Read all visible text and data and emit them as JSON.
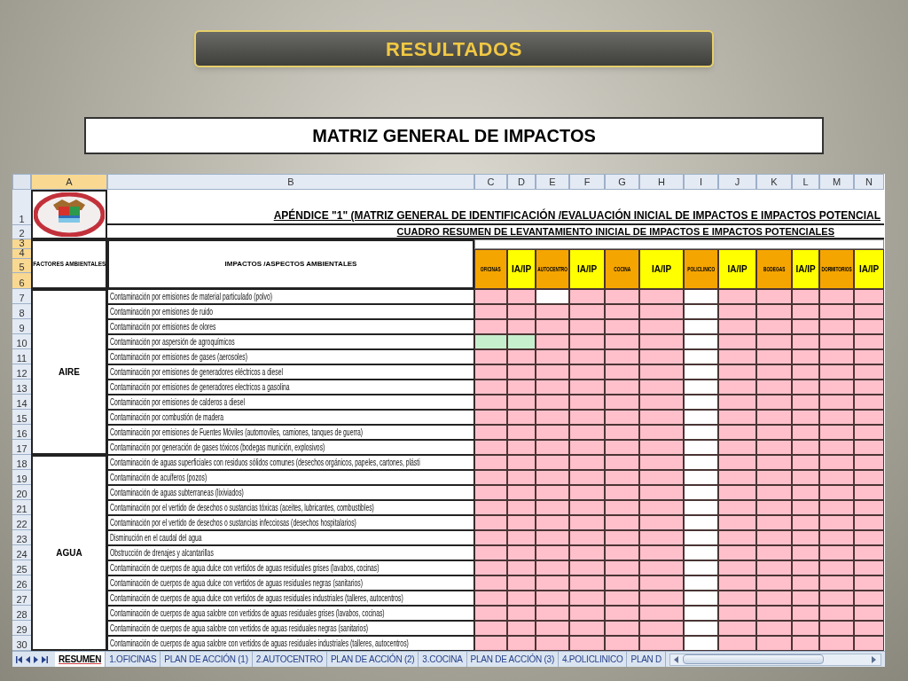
{
  "slide": {
    "banner": "RESULTADOS",
    "title": "MATRIZ GENERAL DE IMPACTOS"
  },
  "sheet": {
    "column_headers": [
      {
        "label": "A",
        "selected": true
      },
      {
        "label": "B",
        "selected": false
      },
      {
        "label": "C",
        "selected": false
      },
      {
        "label": "D",
        "selected": false
      },
      {
        "label": "E",
        "selected": false
      },
      {
        "label": "F",
        "selected": false
      },
      {
        "label": "G",
        "selected": false
      },
      {
        "label": "H",
        "selected": false
      },
      {
        "label": "I",
        "selected": false
      },
      {
        "label": "J",
        "selected": false
      },
      {
        "label": "K",
        "selected": false
      },
      {
        "label": "L",
        "selected": false
      },
      {
        "label": "M",
        "selected": false
      },
      {
        "label": "N",
        "selected": false
      }
    ],
    "row_headers": [
      {
        "label": "1",
        "selected": false
      },
      {
        "label": "2",
        "selected": false
      },
      {
        "label": "3",
        "selected": true
      },
      {
        "label": "4",
        "selected": true
      },
      {
        "label": "5",
        "selected": true
      },
      {
        "label": "6",
        "selected": true
      },
      {
        "label": "7",
        "selected": false
      },
      {
        "label": "8",
        "selected": false
      },
      {
        "label": "9",
        "selected": false
      },
      {
        "label": "10",
        "selected": false
      },
      {
        "label": "11",
        "selected": false
      },
      {
        "label": "12",
        "selected": false
      },
      {
        "label": "13",
        "selected": false
      },
      {
        "label": "14",
        "selected": false
      },
      {
        "label": "15",
        "selected": false
      },
      {
        "label": "16",
        "selected": false
      },
      {
        "label": "17",
        "selected": false
      },
      {
        "label": "18",
        "selected": false
      },
      {
        "label": "19",
        "selected": false
      },
      {
        "label": "20",
        "selected": false
      },
      {
        "label": "21",
        "selected": false
      },
      {
        "label": "22",
        "selected": false
      },
      {
        "label": "23",
        "selected": false
      },
      {
        "label": "24",
        "selected": false
      },
      {
        "label": "25",
        "selected": false
      },
      {
        "label": "26",
        "selected": false
      },
      {
        "label": "27",
        "selected": false
      },
      {
        "label": "28",
        "selected": false
      },
      {
        "label": "29",
        "selected": false
      },
      {
        "label": "30",
        "selected": false
      }
    ],
    "title": "APÉNDICE \"1\" (MATRIZ GENERAL DE IDENTIFICACIÓN /EVALUACIÓN INICIAL DE IMPACTOS E IMPACTOS POTENCIAL",
    "subtitle": "CUADRO RESUMEN DE LEVANTAMIENTO INICIAL DE IMPACTOS E IMPACTOS POTENCIALES",
    "factor_heading": "FACTORES AMBIENTALES",
    "impact_heading": "IMPACTOS /ASPECTOS AMBIENTALES",
    "area_columns": [
      {
        "label": "OFICINAS",
        "kind": "area"
      },
      {
        "label": "IA/IP",
        "kind": "rating"
      },
      {
        "label": "AUTOCENTRO",
        "kind": "area"
      },
      {
        "label": "IA/IP",
        "kind": "rating"
      },
      {
        "label": "COCINA",
        "kind": "area"
      },
      {
        "label": "IA/IP",
        "kind": "rating"
      },
      {
        "label": "POLICLINICO",
        "kind": "area"
      },
      {
        "label": "IA/IP",
        "kind": "rating"
      },
      {
        "label": "BODEGAS",
        "kind": "area"
      },
      {
        "label": "IA/IP",
        "kind": "rating"
      },
      {
        "label": "DORMITORIOS",
        "kind": "area"
      },
      {
        "label": "IA/IP",
        "kind": "rating"
      }
    ],
    "groups": [
      {
        "factor": "AIRE",
        "rows": [
          {
            "impact": "Contaminación por emisiones de material particulado (polvo)",
            "cells": [
              {
                "color": "#ffc0cb"
              },
              {
                "color": "#ffc0cb"
              },
              {
                "color": "#ffffff"
              },
              {
                "color": "#ffc0cb"
              },
              {
                "color": "#ffc0cb"
              },
              {
                "color": "#ffc0cb"
              },
              {
                "color": "#ffffff"
              },
              {
                "color": "#ffc0cb"
              },
              {
                "color": "#ffc0cb"
              },
              {
                "color": "#ffc0cb"
              },
              {
                "color": "#ffc0cb"
              },
              {
                "color": "#ffc0cb"
              }
            ]
          },
          {
            "impact": "Contaminación por emisiones de ruido",
            "cells": [
              {
                "color": "#ffc0cb"
              },
              {
                "color": "#ffc0cb"
              },
              {
                "color": "#ffc0cb"
              },
              {
                "color": "#ffc0cb"
              },
              {
                "color": "#ffc0cb"
              },
              {
                "color": "#ffc0cb"
              },
              {
                "color": "#ffffff"
              },
              {
                "color": "#ffc0cb"
              },
              {
                "color": "#ffc0cb"
              },
              {
                "color": "#ffc0cb"
              },
              {
                "color": "#ffc0cb"
              },
              {
                "color": "#ffc0cb"
              }
            ]
          },
          {
            "impact": "Contaminación por emisiones de olores",
            "cells": [
              {
                "color": "#ffc0cb"
              },
              {
                "color": "#ffc0cb"
              },
              {
                "color": "#ffc0cb"
              },
              {
                "color": "#ffc0cb"
              },
              {
                "color": "#ffc0cb"
              },
              {
                "color": "#ffc0cb"
              },
              {
                "color": "#ffffff"
              },
              {
                "color": "#ffc0cb"
              },
              {
                "color": "#ffc0cb"
              },
              {
                "color": "#ffc0cb"
              },
              {
                "color": "#ffc0cb"
              },
              {
                "color": "#ffc0cb"
              }
            ]
          },
          {
            "impact": "Contaminación por aspersión de agroquímicos",
            "cells": [
              {
                "color": "#c6efce"
              },
              {
                "color": "#c6efce"
              },
              {
                "color": "#ffc0cb"
              },
              {
                "color": "#ffc0cb"
              },
              {
                "color": "#ffc0cb"
              },
              {
                "color": "#ffc0cb"
              },
              {
                "color": "#ffffff"
              },
              {
                "color": "#ffc0cb"
              },
              {
                "color": "#ffc0cb"
              },
              {
                "color": "#ffc0cb"
              },
              {
                "color": "#ffc0cb"
              },
              {
                "color": "#ffc0cb"
              }
            ]
          },
          {
            "impact": "Contaminación por emisiones de gases (aerosoles)",
            "cells": [
              {
                "color": "#ffc0cb"
              },
              {
                "color": "#ffc0cb"
              },
              {
                "color": "#ffc0cb"
              },
              {
                "color": "#ffc0cb"
              },
              {
                "color": "#ffc0cb"
              },
              {
                "color": "#ffc0cb"
              },
              {
                "color": "#ffffff"
              },
              {
                "color": "#ffc0cb"
              },
              {
                "color": "#ffc0cb"
              },
              {
                "color": "#ffc0cb"
              },
              {
                "color": "#ffc0cb"
              },
              {
                "color": "#ffc0cb"
              }
            ]
          },
          {
            "impact": "Contaminación por emisiones de generadores eléctricos a diesel",
            "cells": [
              {
                "color": "#ffc0cb"
              },
              {
                "color": "#ffc0cb"
              },
              {
                "color": "#ffc0cb"
              },
              {
                "color": "#ffc0cb"
              },
              {
                "color": "#ffc0cb"
              },
              {
                "color": "#ffc0cb"
              },
              {
                "color": "#ffffff"
              },
              {
                "color": "#ffc0cb"
              },
              {
                "color": "#ffc0cb"
              },
              {
                "color": "#ffc0cb"
              },
              {
                "color": "#ffc0cb"
              },
              {
                "color": "#ffc0cb"
              }
            ]
          },
          {
            "impact": "Contaminación por emisiones de generadores electricos a gasolina",
            "cells": [
              {
                "color": "#ffc0cb"
              },
              {
                "color": "#ffc0cb"
              },
              {
                "color": "#ffc0cb"
              },
              {
                "color": "#ffc0cb"
              },
              {
                "color": "#ffc0cb"
              },
              {
                "color": "#ffc0cb"
              },
              {
                "color": "#ffffff"
              },
              {
                "color": "#ffc0cb"
              },
              {
                "color": "#ffc0cb"
              },
              {
                "color": "#ffc0cb"
              },
              {
                "color": "#ffc0cb"
              },
              {
                "color": "#ffc0cb"
              }
            ]
          },
          {
            "impact": "Contaminación por emisiones de calderos a diesel",
            "cells": [
              {
                "color": "#ffc0cb"
              },
              {
                "color": "#ffc0cb"
              },
              {
                "color": "#ffc0cb"
              },
              {
                "color": "#ffc0cb"
              },
              {
                "color": "#ffc0cb"
              },
              {
                "color": "#ffc0cb"
              },
              {
                "color": "#ffffff"
              },
              {
                "color": "#ffc0cb"
              },
              {
                "color": "#ffc0cb"
              },
              {
                "color": "#ffc0cb"
              },
              {
                "color": "#ffc0cb"
              },
              {
                "color": "#ffc0cb"
              }
            ]
          },
          {
            "impact": "Contaminación por combustión de madera",
            "cells": [
              {
                "color": "#ffc0cb"
              },
              {
                "color": "#ffc0cb"
              },
              {
                "color": "#ffc0cb"
              },
              {
                "color": "#ffc0cb"
              },
              {
                "color": "#ffc0cb"
              },
              {
                "color": "#ffc0cb"
              },
              {
                "color": "#ffffff"
              },
              {
                "color": "#ffc0cb"
              },
              {
                "color": "#ffc0cb"
              },
              {
                "color": "#ffc0cb"
              },
              {
                "color": "#ffc0cb"
              },
              {
                "color": "#ffc0cb"
              }
            ]
          },
          {
            "impact": "Contaminación por emisiones de Fuentes Móviles (automoviles, camiones, tanques de guerra)",
            "cells": [
              {
                "color": "#ffc0cb"
              },
              {
                "color": "#ffc0cb"
              },
              {
                "color": "#ffc0cb"
              },
              {
                "color": "#ffc0cb"
              },
              {
                "color": "#ffc0cb"
              },
              {
                "color": "#ffc0cb"
              },
              {
                "color": "#ffffff"
              },
              {
                "color": "#ffc0cb"
              },
              {
                "color": "#ffc0cb"
              },
              {
                "color": "#ffc0cb"
              },
              {
                "color": "#ffc0cb"
              },
              {
                "color": "#ffc0cb"
              }
            ]
          },
          {
            "impact": "Contaminación por generación de gases tóxicos (bodegas munición, explosivos)",
            "cells": [
              {
                "color": "#ffc0cb"
              },
              {
                "color": "#ffc0cb"
              },
              {
                "color": "#ffc0cb"
              },
              {
                "color": "#ffc0cb"
              },
              {
                "color": "#ffc0cb"
              },
              {
                "color": "#ffc0cb"
              },
              {
                "color": "#ffffff"
              },
              {
                "color": "#ffc0cb"
              },
              {
                "color": "#ffc0cb"
              },
              {
                "color": "#ffc0cb"
              },
              {
                "color": "#ffc0cb"
              },
              {
                "color": "#ffc0cb"
              }
            ]
          }
        ]
      },
      {
        "factor": "AGUA",
        "rows": [
          {
            "impact": "Contaminación de aguas superficiales con residuos sólidos comunes (desechos orgánicos, papeles, cartones, plásti",
            "cells": [
              {
                "color": "#ffc0cb"
              },
              {
                "color": "#ffc0cb"
              },
              {
                "color": "#ffc0cb"
              },
              {
                "color": "#ffc0cb"
              },
              {
                "color": "#ffc0cb"
              },
              {
                "color": "#ffc0cb"
              },
              {
                "color": "#ffffff"
              },
              {
                "color": "#ffc0cb"
              },
              {
                "color": "#ffc0cb"
              },
              {
                "color": "#ffc0cb"
              },
              {
                "color": "#ffc0cb"
              },
              {
                "color": "#ffc0cb"
              }
            ]
          },
          {
            "impact": "Contaminación de acuíferos (pozos)",
            "cells": [
              {
                "color": "#ffc0cb"
              },
              {
                "color": "#ffc0cb"
              },
              {
                "color": "#ffc0cb"
              },
              {
                "color": "#ffc0cb"
              },
              {
                "color": "#ffc0cb"
              },
              {
                "color": "#ffc0cb"
              },
              {
                "color": "#ffffff"
              },
              {
                "color": "#ffc0cb"
              },
              {
                "color": "#ffc0cb"
              },
              {
                "color": "#ffc0cb"
              },
              {
                "color": "#ffc0cb"
              },
              {
                "color": "#ffc0cb"
              }
            ]
          },
          {
            "impact": "Contaminación de aguas subterraneas (lixiviados)",
            "cells": [
              {
                "color": "#ffc0cb"
              },
              {
                "color": "#ffc0cb"
              },
              {
                "color": "#ffc0cb"
              },
              {
                "color": "#ffc0cb"
              },
              {
                "color": "#ffc0cb"
              },
              {
                "color": "#ffc0cb"
              },
              {
                "color": "#ffffff"
              },
              {
                "color": "#ffc0cb"
              },
              {
                "color": "#ffc0cb"
              },
              {
                "color": "#ffc0cb"
              },
              {
                "color": "#ffc0cb"
              },
              {
                "color": "#ffc0cb"
              }
            ]
          },
          {
            "impact": "Contaminación por el vertido de desechos o sustancias tóxicas (aceites, lubricantes, combustibles)",
            "cells": [
              {
                "color": "#ffc0cb"
              },
              {
                "color": "#ffc0cb"
              },
              {
                "color": "#ffc0cb"
              },
              {
                "color": "#ffc0cb"
              },
              {
                "color": "#ffc0cb"
              },
              {
                "color": "#ffc0cb"
              },
              {
                "color": "#ffffff"
              },
              {
                "color": "#ffc0cb"
              },
              {
                "color": "#ffc0cb"
              },
              {
                "color": "#ffc0cb"
              },
              {
                "color": "#ffc0cb"
              },
              {
                "color": "#ffc0cb"
              }
            ]
          },
          {
            "impact": "Contaminación por el vertido de desechos o sustancias infecciosas (desechos hospitalarios)",
            "cells": [
              {
                "color": "#ffc0cb"
              },
              {
                "color": "#ffc0cb"
              },
              {
                "color": "#ffc0cb"
              },
              {
                "color": "#ffc0cb"
              },
              {
                "color": "#ffc0cb"
              },
              {
                "color": "#ffc0cb"
              },
              {
                "color": "#ffffff"
              },
              {
                "color": "#ffc0cb"
              },
              {
                "color": "#ffc0cb"
              },
              {
                "color": "#ffc0cb"
              },
              {
                "color": "#ffc0cb"
              },
              {
                "color": "#ffc0cb"
              }
            ]
          },
          {
            "impact": "Disminución en el caudal del agua",
            "cells": [
              {
                "color": "#ffc0cb"
              },
              {
                "color": "#ffc0cb"
              },
              {
                "color": "#ffc0cb"
              },
              {
                "color": "#ffc0cb"
              },
              {
                "color": "#ffc0cb"
              },
              {
                "color": "#ffc0cb"
              },
              {
                "color": "#ffffff"
              },
              {
                "color": "#ffc0cb"
              },
              {
                "color": "#ffc0cb"
              },
              {
                "color": "#ffc0cb"
              },
              {
                "color": "#ffc0cb"
              },
              {
                "color": "#ffc0cb"
              }
            ]
          },
          {
            "impact": "Obstrucción de drenajes y alcantarillas",
            "cells": [
              {
                "color": "#ffc0cb"
              },
              {
                "color": "#ffc0cb"
              },
              {
                "color": "#ffc0cb"
              },
              {
                "color": "#ffc0cb"
              },
              {
                "color": "#ffc0cb"
              },
              {
                "color": "#ffc0cb"
              },
              {
                "color": "#ffffff"
              },
              {
                "color": "#ffc0cb"
              },
              {
                "color": "#ffc0cb"
              },
              {
                "color": "#ffc0cb"
              },
              {
                "color": "#ffc0cb"
              },
              {
                "color": "#ffc0cb"
              }
            ]
          },
          {
            "impact": "Contaminación de cuerpos de agua dulce con vertidos de aguas residuales grises (lavabos, cocinas)",
            "cells": [
              {
                "color": "#ffc0cb"
              },
              {
                "color": "#ffc0cb"
              },
              {
                "color": "#ffc0cb"
              },
              {
                "color": "#ffc0cb"
              },
              {
                "color": "#ffc0cb"
              },
              {
                "color": "#ffc0cb"
              },
              {
                "color": "#ffffff"
              },
              {
                "color": "#ffc0cb"
              },
              {
                "color": "#ffc0cb"
              },
              {
                "color": "#ffc0cb"
              },
              {
                "color": "#ffc0cb"
              },
              {
                "color": "#ffc0cb"
              }
            ]
          },
          {
            "impact": "Contaminación de cuerpos de agua dulce con vertidos de aguas residuales negras (sanitarios)",
            "cells": [
              {
                "color": "#ffc0cb"
              },
              {
                "color": "#ffc0cb"
              },
              {
                "color": "#ffc0cb"
              },
              {
                "color": "#ffc0cb"
              },
              {
                "color": "#ffc0cb"
              },
              {
                "color": "#ffc0cb"
              },
              {
                "color": "#ffffff"
              },
              {
                "color": "#ffc0cb"
              },
              {
                "color": "#ffc0cb"
              },
              {
                "color": "#ffc0cb"
              },
              {
                "color": "#ffc0cb"
              },
              {
                "color": "#ffc0cb"
              }
            ]
          },
          {
            "impact": "Contaminación de cuerpos de agua dulce con vertidos de aguas residuales industriales (talleres, autocentros)",
            "cells": [
              {
                "color": "#ffc0cb"
              },
              {
                "color": "#ffc0cb"
              },
              {
                "color": "#ffc0cb"
              },
              {
                "color": "#ffc0cb"
              },
              {
                "color": "#ffc0cb"
              },
              {
                "color": "#ffc0cb"
              },
              {
                "color": "#ffffff"
              },
              {
                "color": "#ffc0cb"
              },
              {
                "color": "#ffc0cb"
              },
              {
                "color": "#ffc0cb"
              },
              {
                "color": "#ffc0cb"
              },
              {
                "color": "#ffc0cb"
              }
            ]
          },
          {
            "impact": "Contaminación de cuerpos de agua salobre con vertidos de aguas residuales grises (lavabos, cocinas)",
            "cells": [
              {
                "color": "#ffc0cb"
              },
              {
                "color": "#ffc0cb"
              },
              {
                "color": "#ffc0cb"
              },
              {
                "color": "#ffc0cb"
              },
              {
                "color": "#ffc0cb"
              },
              {
                "color": "#ffc0cb"
              },
              {
                "color": "#ffffff"
              },
              {
                "color": "#ffc0cb"
              },
              {
                "color": "#ffc0cb"
              },
              {
                "color": "#ffc0cb"
              },
              {
                "color": "#ffc0cb"
              },
              {
                "color": "#ffc0cb"
              }
            ]
          },
          {
            "impact": "Contaminación de cuerpos de agua salobre con vertidos de aguas residuales negras (sanitarios)",
            "cells": [
              {
                "color": "#ffc0cb"
              },
              {
                "color": "#ffc0cb"
              },
              {
                "color": "#ffc0cb"
              },
              {
                "color": "#ffc0cb"
              },
              {
                "color": "#ffc0cb"
              },
              {
                "color": "#ffc0cb"
              },
              {
                "color": "#ffffff"
              },
              {
                "color": "#ffc0cb"
              },
              {
                "color": "#ffc0cb"
              },
              {
                "color": "#ffc0cb"
              },
              {
                "color": "#ffc0cb"
              },
              {
                "color": "#ffc0cb"
              }
            ]
          },
          {
            "impact": "Contaminación de cuerpos de agua salobre con vertidos de aguas residuales industriales (talleres, autocentros)",
            "cells": [
              {
                "color": "#ffc0cb"
              },
              {
                "color": "#ffc0cb"
              },
              {
                "color": "#ffc0cb"
              },
              {
                "color": "#ffc0cb"
              },
              {
                "color": "#ffc0cb"
              },
              {
                "color": "#ffc0cb"
              },
              {
                "color": "#ffffff"
              },
              {
                "color": "#ffc0cb"
              },
              {
                "color": "#ffc0cb"
              },
              {
                "color": "#ffc0cb"
              },
              {
                "color": "#ffc0cb"
              },
              {
                "color": "#ffc0cb"
              }
            ]
          }
        ]
      }
    ],
    "tabs": [
      {
        "label": "RESUMEN",
        "selected": true
      },
      {
        "label": "1.OFICINAS",
        "selected": false
      },
      {
        "label": "PLAN DE ACCIÓN (1)",
        "selected": false
      },
      {
        "label": "2.AUTOCENTRO",
        "selected": false
      },
      {
        "label": "PLAN DE ACCIÓN (2)",
        "selected": false
      },
      {
        "label": "3.COCINA",
        "selected": false
      },
      {
        "label": "PLAN DE ACCIÓN (3)",
        "selected": false
      },
      {
        "label": "4.POLICLINICO",
        "selected": false
      },
      {
        "label": "PLAN D",
        "selected": false
      }
    ]
  }
}
